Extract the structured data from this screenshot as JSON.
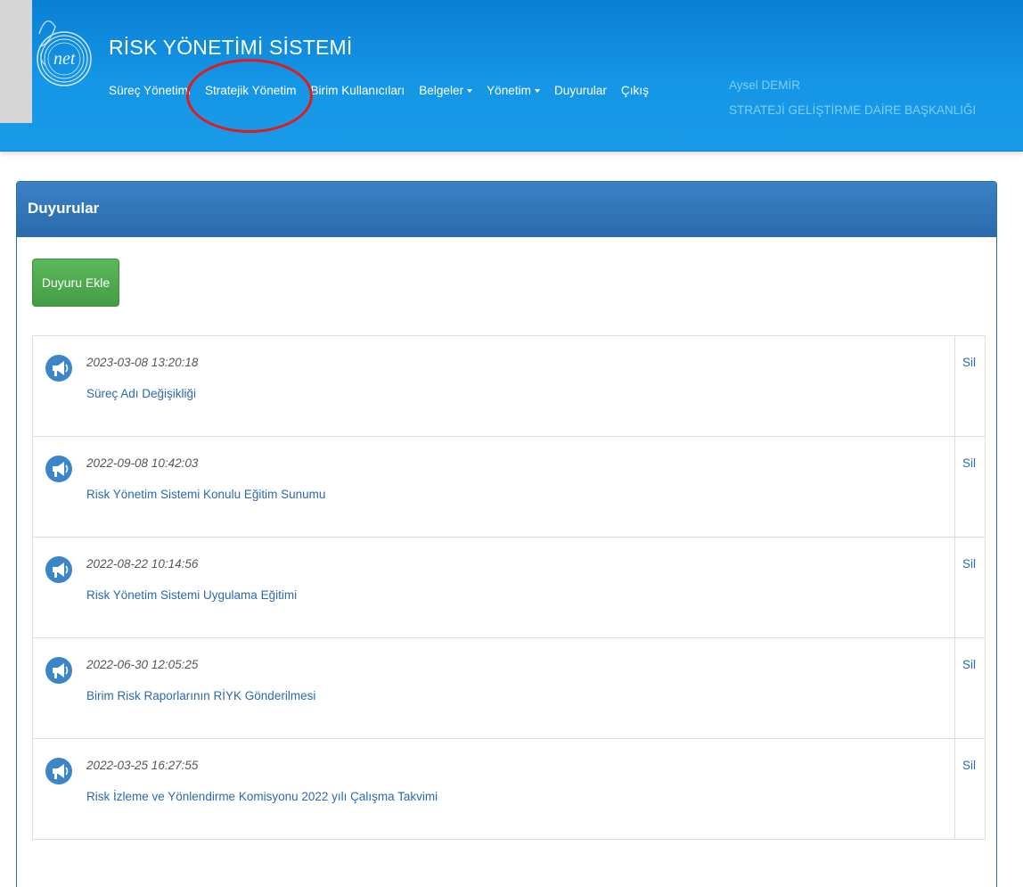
{
  "header": {
    "app_title": "RİSK YÖNETİMİ SİSTEMİ",
    "logo_text": "net",
    "accent_color": "#1596e6",
    "highlight_color": "#e01b1b"
  },
  "nav": {
    "items": [
      {
        "label": "Süreç Yönetimi",
        "dropdown": false
      },
      {
        "label": "Stratejik Yönetim",
        "dropdown": false,
        "highlighted": true
      },
      {
        "label": "Birim Kullanıcıları",
        "dropdown": false
      },
      {
        "label": "Belgeler",
        "dropdown": true
      },
      {
        "label": "Yönetim",
        "dropdown": true
      },
      {
        "label": "Duyurular",
        "dropdown": false
      },
      {
        "label": "Çıkış",
        "dropdown": false
      }
    ]
  },
  "user": {
    "name": "Aysel DEMİR",
    "department": "STRATEJİ GELİŞTİRME DAİRE BAŞKANLIĞI"
  },
  "panel": {
    "title": "Duyurular",
    "add_button_label": "Duyuru Ekle",
    "add_button_color": "#5cb85c"
  },
  "announcements": [
    {
      "date": "2023-03-08 13:20:18",
      "title": "Süreç Adı Değişikliği",
      "delete_label": "Sil",
      "icon": "megaphone-icon"
    },
    {
      "date": "2022-09-08 10:42:03",
      "title": "Risk Yönetim Sistemi Konulu Eğitim Sunumu",
      "delete_label": "Sil",
      "icon": "megaphone-icon"
    },
    {
      "date": "2022-08-22 10:14:56",
      "title": "Risk Yönetim Sistemi Uygulama Eğitimi",
      "delete_label": "Sil",
      "icon": "megaphone-icon"
    },
    {
      "date": "2022-06-30 12:05:25",
      "title": "Birim Risk Raporlarının RİYK Gönderilmesi",
      "delete_label": "Sil",
      "icon": "megaphone-icon"
    },
    {
      "date": "2022-03-25 16:27:55",
      "title": "Risk İzleme ve Yönlendirme Komisyonu 2022 yılı Çalışma Takvimi",
      "delete_label": "Sil",
      "icon": "megaphone-icon"
    }
  ]
}
